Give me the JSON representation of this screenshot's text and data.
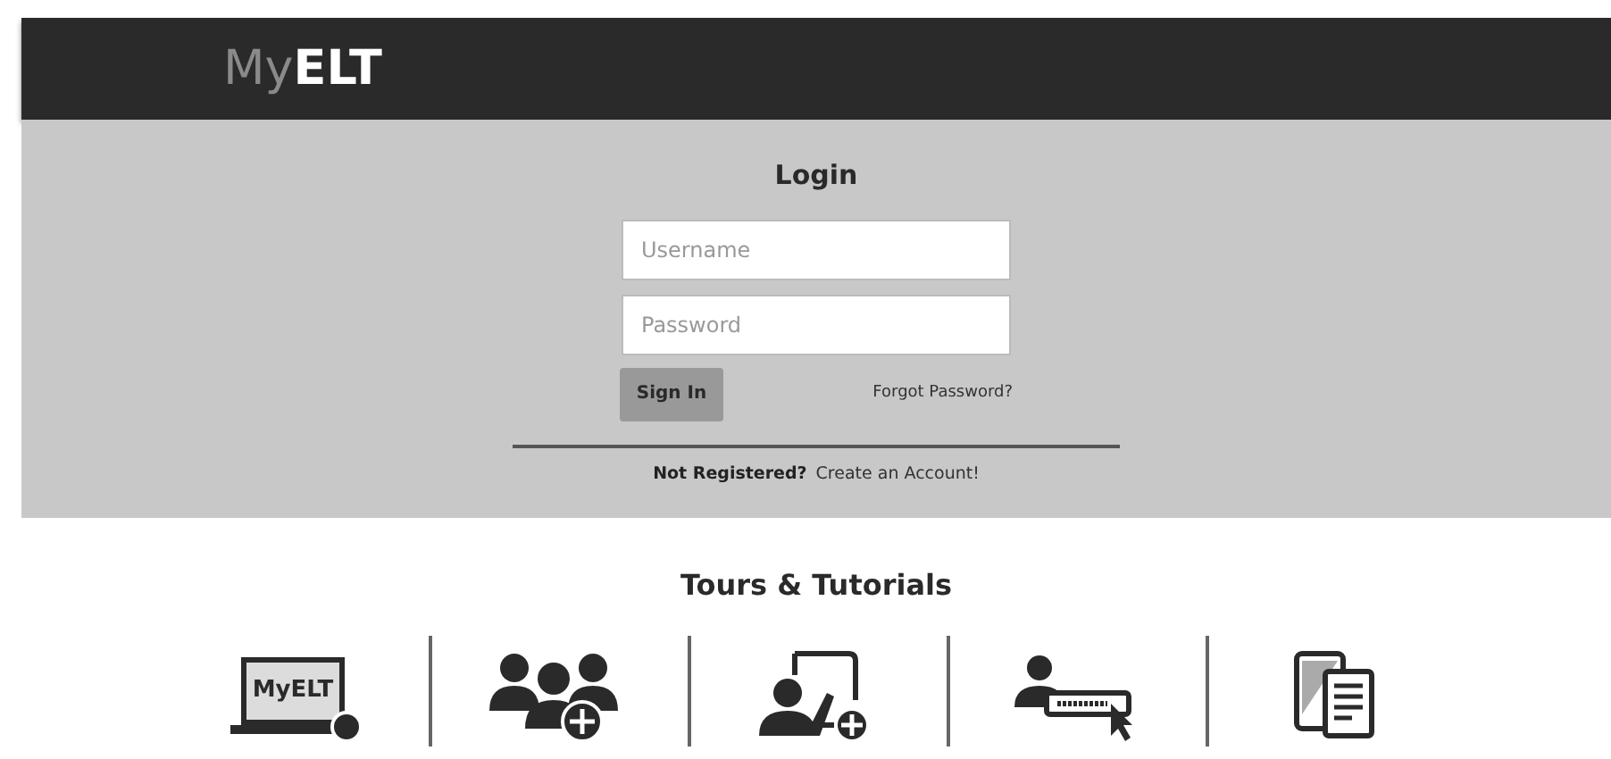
{
  "header": {
    "logo_light": "My",
    "logo_bold": "ELT"
  },
  "login": {
    "title": "Login",
    "username": {
      "placeholder": "Username"
    },
    "password": {
      "placeholder": "Password"
    },
    "sign_in": "Sign In",
    "forgot": "Forgot Password?",
    "not_registered": "Not Registered?",
    "create_account": "Create an Account!"
  },
  "tutorials": {
    "title": "Tours & Tutorials",
    "items": [
      {
        "kind": "laptop",
        "label": "MyELT"
      },
      {
        "kind": "group"
      },
      {
        "kind": "board"
      },
      {
        "kind": "login"
      },
      {
        "kind": "devices"
      }
    ]
  }
}
